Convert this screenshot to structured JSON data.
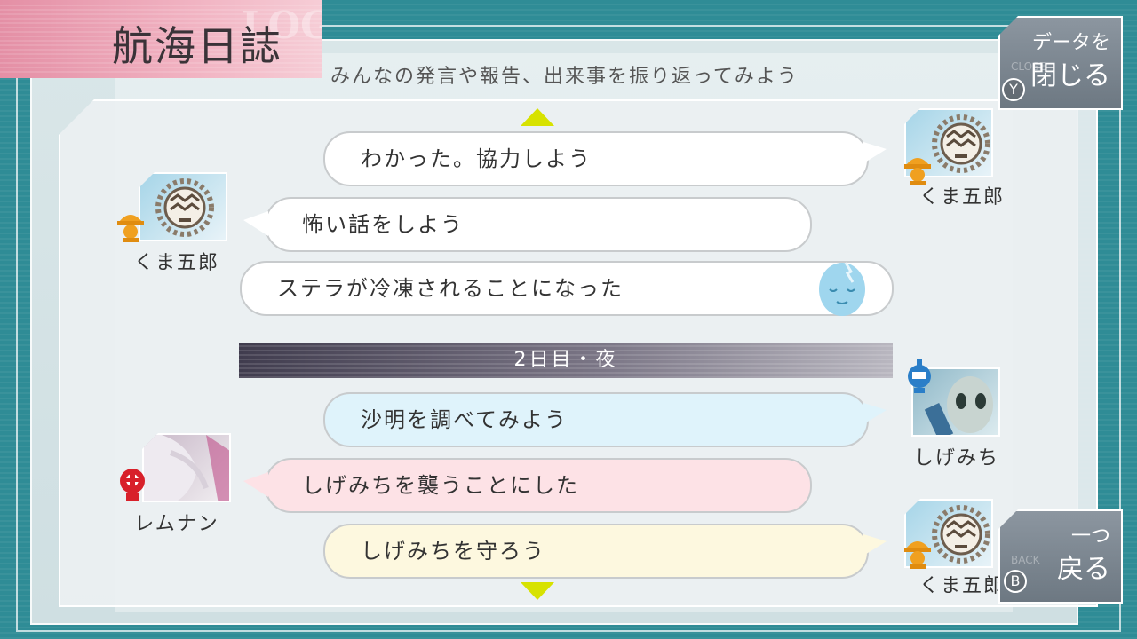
{
  "header": {
    "title": "航海日誌",
    "title_ghost": "LOG",
    "subtitle": "みんなの発言や報告、出来事を振り返ってみよう"
  },
  "buttons": {
    "close": {
      "line1": "データを",
      "line2": "閉じる",
      "key": "Y",
      "ghost": "CLOSE"
    },
    "back": {
      "line1": "一つ",
      "line2": "戻る",
      "key": "B",
      "ghost": "BACK"
    }
  },
  "log": [
    {
      "speaker": "くま五郎",
      "text": "わかった。協力しよう",
      "side": "right",
      "color": "#ffffff"
    },
    {
      "speaker": "くま五郎",
      "text": "怖い話をしよう",
      "side": "left",
      "color": "#ffffff"
    },
    {
      "speaker": "",
      "text": "ステラが冷凍されることになった",
      "side": "none",
      "color": "#ffffff"
    },
    {
      "divider": "2日目・夜"
    },
    {
      "speaker": "しげみち",
      "text": "沙明を調べてみよう",
      "side": "right",
      "color": "#dff3fb"
    },
    {
      "speaker": "レムナン",
      "text": "しげみちを襲うことにした",
      "side": "left",
      "color": "#fde2e6"
    },
    {
      "speaker": "くま五郎",
      "text": "しげみちを守ろう",
      "side": "right",
      "color": "#fdf8df"
    }
  ],
  "icons": {
    "scroll_up": "triangle-up-icon",
    "scroll_down": "triangle-down-icon",
    "engineer_badge": "hardhat-icon",
    "guard_badge": "robot-head-icon",
    "gnosia_badge": "skull-icon"
  },
  "colors": {
    "accent_pink": "#e48fa5",
    "scroll_arrow": "#d7e200",
    "teal_bg": "#2f8c96"
  }
}
